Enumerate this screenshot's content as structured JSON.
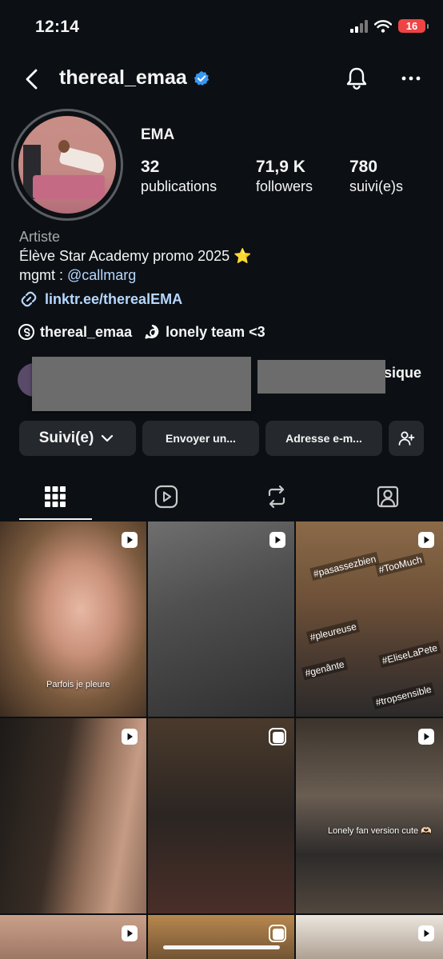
{
  "status": {
    "time": "12:14",
    "battery": "16"
  },
  "header": {
    "username": "thereal_emaa"
  },
  "profile": {
    "name": "EMA",
    "stats": [
      {
        "value": "32",
        "label": "publications"
      },
      {
        "value": "71,9 K",
        "label": "followers"
      },
      {
        "value": "780",
        "label": "suivi(e)s"
      }
    ],
    "bio": {
      "category": "Artiste",
      "line1": "Élève Star Academy promo 2025 ⭐",
      "mgmt_prefix": "mgmt : ",
      "mgmt_handle": "@callmarg",
      "link": "linktr.ee/therealEMA"
    },
    "threads_handle": "thereal_emaa",
    "channel": "lonely team <3",
    "mutual_text_fragment": "sique"
  },
  "actions": {
    "follow": "Suivi(e)",
    "message": "Envoyer un...",
    "email": "Adresse e-m..."
  },
  "grid": {
    "captions": {
      "t1": "Parfois je pleure",
      "t6": "Lonely fan version cute 🫶🏻"
    },
    "tags": [
      "#pasassezbien",
      "#TooMuch",
      "#pleureuse",
      "#EliseLaPete",
      "#genânte",
      "#tropsensible"
    ]
  },
  "colors": {
    "background": "#0c1014",
    "button": "#25292e",
    "link": "#b6d7ff",
    "verified": "#3897f0"
  }
}
